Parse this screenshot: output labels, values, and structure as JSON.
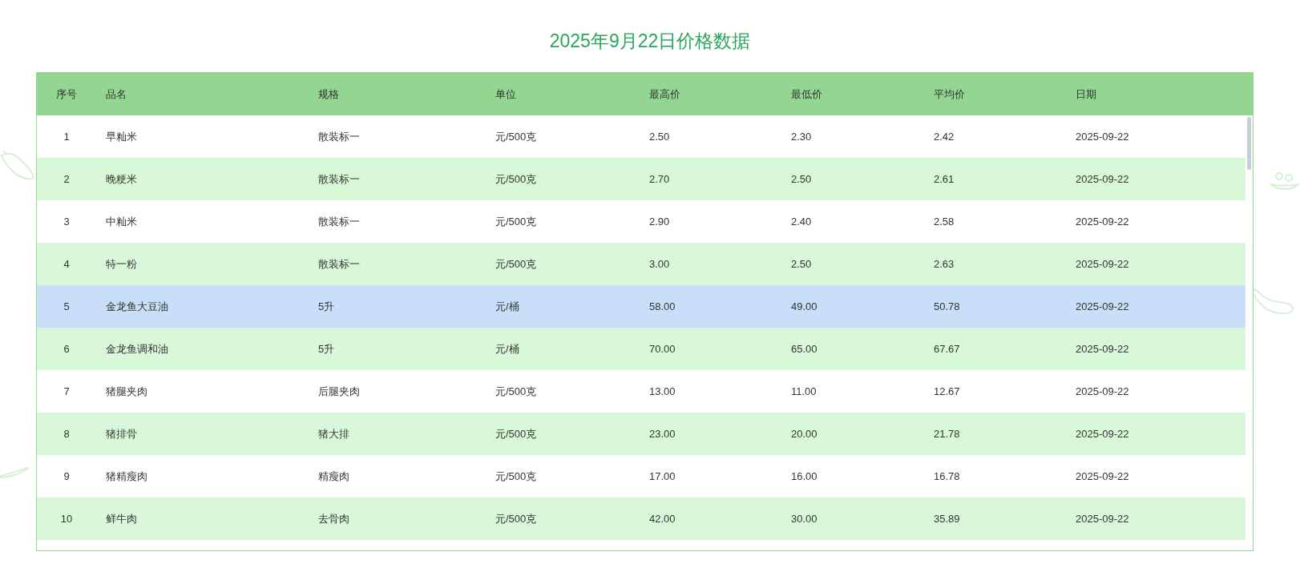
{
  "title": "2025年9月22日价格数据",
  "table": {
    "columns": [
      "序号",
      "品名",
      "规格",
      "单位",
      "最高价",
      "最低价",
      "平均价",
      "日期"
    ],
    "rows": [
      {
        "cells": [
          "1",
          "早籼米",
          "散装标一",
          "元/500克",
          "2.50",
          "2.30",
          "2.42",
          "2025-09-22"
        ],
        "selected": false
      },
      {
        "cells": [
          "2",
          "晚粳米",
          "散装标一",
          "元/500克",
          "2.70",
          "2.50",
          "2.61",
          "2025-09-22"
        ],
        "selected": false
      },
      {
        "cells": [
          "3",
          "中籼米",
          "散装标一",
          "元/500克",
          "2.90",
          "2.40",
          "2.58",
          "2025-09-22"
        ],
        "selected": false
      },
      {
        "cells": [
          "4",
          "特一粉",
          "散装标一",
          "元/500克",
          "3.00",
          "2.50",
          "2.63",
          "2025-09-22"
        ],
        "selected": false
      },
      {
        "cells": [
          "5",
          "金龙鱼大豆油",
          "5升",
          "元/桶",
          "58.00",
          "49.00",
          "50.78",
          "2025-09-22"
        ],
        "selected": true
      },
      {
        "cells": [
          "6",
          "金龙鱼调和油",
          "5升",
          "元/桶",
          "70.00",
          "65.00",
          "67.67",
          "2025-09-22"
        ],
        "selected": false
      },
      {
        "cells": [
          "7",
          "猪腿夹肉",
          "后腿夹肉",
          "元/500克",
          "13.00",
          "11.00",
          "12.67",
          "2025-09-22"
        ],
        "selected": false
      },
      {
        "cells": [
          "8",
          "猪排骨",
          "猪大排",
          "元/500克",
          "23.00",
          "20.00",
          "21.78",
          "2025-09-22"
        ],
        "selected": false
      },
      {
        "cells": [
          "9",
          "猪精瘦肉",
          "精瘦肉",
          "元/500克",
          "17.00",
          "16.00",
          "16.78",
          "2025-09-22"
        ],
        "selected": false
      },
      {
        "cells": [
          "10",
          "鲜牛肉",
          "去骨肉",
          "元/500克",
          "42.00",
          "30.00",
          "35.89",
          "2025-09-22"
        ],
        "selected": false
      }
    ]
  }
}
